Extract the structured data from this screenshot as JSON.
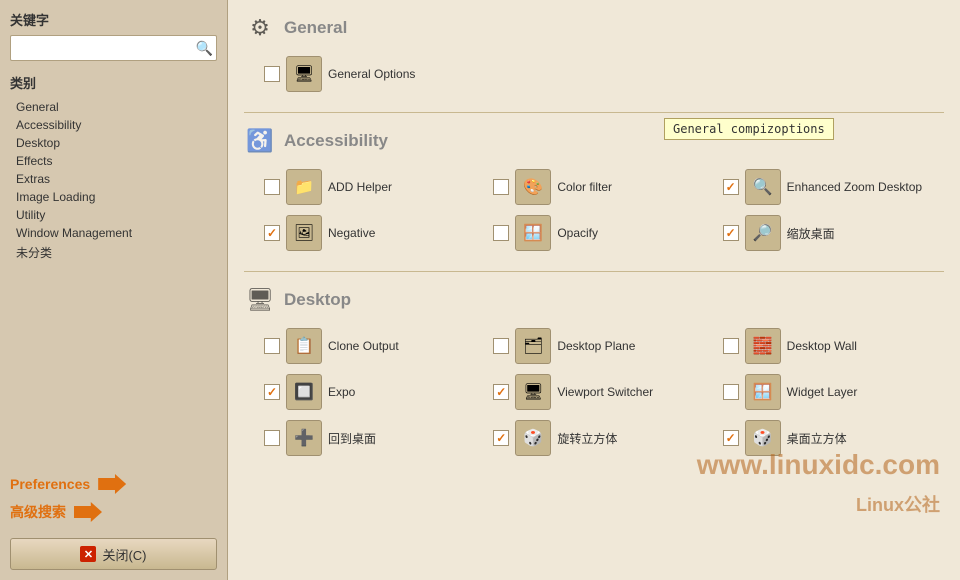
{
  "sidebar": {
    "keyword_label": "关键字",
    "search_placeholder": "",
    "category_label": "类别",
    "nav_items": [
      "General",
      "Accessibility",
      "Desktop",
      "Effects",
      "Extras",
      "Image Loading",
      "Utility",
      "Window Management",
      "未分类"
    ],
    "preferences_label": "Preferences",
    "advanced_search_label": "高级搜索",
    "close_label": "关闭(C)"
  },
  "main": {
    "tooltip_text": "General compizoptions",
    "sections": [
      {
        "id": "general",
        "title": "General",
        "icon": "⚙",
        "items": [
          {
            "id": "general-options",
            "label": "General Options",
            "checked": false,
            "icon": "🖥"
          }
        ]
      },
      {
        "id": "accessibility",
        "title": "Accessibility",
        "icon": "♿",
        "items": [
          {
            "id": "add-helper",
            "label": "ADD Helper",
            "checked": false,
            "icon": "📁"
          },
          {
            "id": "color-filter",
            "label": "Color filter",
            "checked": false,
            "icon": "🎨"
          },
          {
            "id": "enhanced-zoom",
            "label": "Enhanced Zoom Desktop",
            "checked": true,
            "icon": "🔍"
          },
          {
            "id": "negative",
            "label": "Negative",
            "checked": true,
            "icon": "🖼"
          },
          {
            "id": "opacify",
            "label": "Opacify",
            "checked": false,
            "icon": "🪟"
          },
          {
            "id": "zoom-desktop",
            "label": "缩放桌面",
            "checked": true,
            "icon": "🔎"
          }
        ]
      },
      {
        "id": "desktop",
        "title": "Desktop",
        "icon": "🖥",
        "items": [
          {
            "id": "clone-output",
            "label": "Clone Output",
            "checked": false,
            "icon": "📋"
          },
          {
            "id": "desktop-plane",
            "label": "Desktop Plane",
            "checked": false,
            "icon": "🗂"
          },
          {
            "id": "desktop-wall",
            "label": "Desktop Wall",
            "checked": false,
            "icon": "🧱"
          },
          {
            "id": "expo",
            "label": "Expo",
            "checked": true,
            "icon": "🔲"
          },
          {
            "id": "viewport-switcher",
            "label": "Viewport Switcher",
            "checked": true,
            "icon": "🖥"
          },
          {
            "id": "widget-layer",
            "label": "Widget Layer",
            "checked": false,
            "icon": "🪟"
          },
          {
            "id": "back-desktop",
            "label": "回到桌面",
            "checked": false,
            "icon": "➕"
          },
          {
            "id": "rotate-cube",
            "label": "旋转立方体",
            "checked": true,
            "icon": "🎲"
          },
          {
            "id": "desktop-cube",
            "label": "桌面立方体",
            "checked": true,
            "icon": "🎲"
          }
        ]
      }
    ]
  }
}
